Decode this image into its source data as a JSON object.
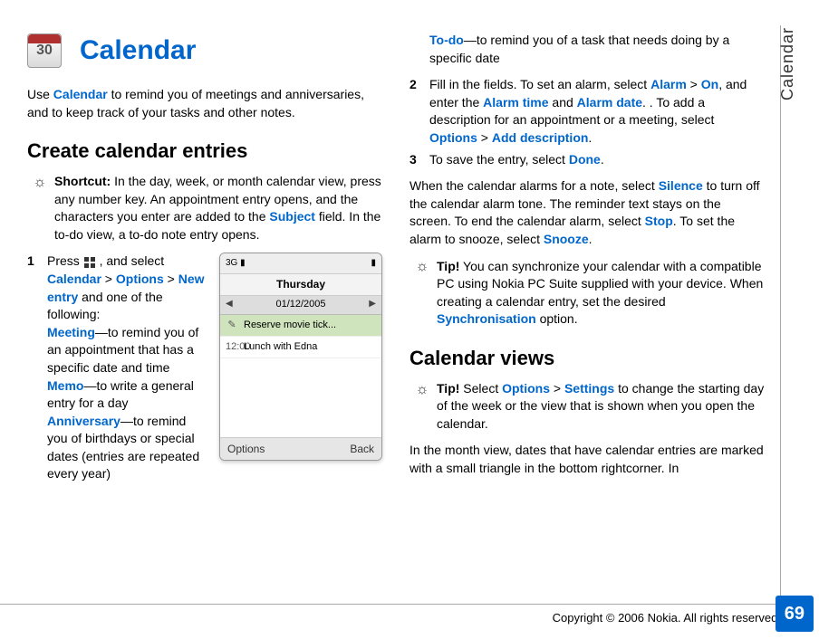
{
  "sideTab": "Calendar",
  "pageNumber": "69",
  "copyright": "Copyright © 2006 Nokia. All rights reserved.",
  "header": {
    "title": "Calendar",
    "iconDay": "30"
  },
  "left": {
    "intro_prefix": "Use ",
    "intro_app": "Calendar",
    "intro_suffix": " to remind you of meetings and anniversaries, and to keep track of your tasks and other notes.",
    "h2_create": "Create calendar entries",
    "shortcut_label": "Shortcut:",
    "shortcut_prefix": " In the day, week, or month calendar view, press any number key. An appointment entry opens, and the characters you enter are added to the ",
    "shortcut_field": "Subject",
    "shortcut_suffix": " field. In the to-do view, a to-do note entry opens.",
    "step1": {
      "num": "1",
      "t0": "Press ",
      "t1": " , and select ",
      "calendar": "Calendar",
      "gt1": " > ",
      "options": "Options",
      "gt2": " > ",
      "newentry": "New entry",
      "t2": " and one of the following:",
      "meeting": "Meeting",
      "meeting_t": "—to remind you of an appointment that has a specific date and time",
      "memo": "Memo",
      "memo_t": "—to write a general entry for a day",
      "anniversary": "Anniversary",
      "anniversary_t": "—to remind you of birthdays or special dates (entries are repeated every year)"
    }
  },
  "right": {
    "todo": "To-do",
    "todo_t": "—to remind you of a task that needs doing by a specific date",
    "step2": {
      "num": "2",
      "t0": "Fill in the fields. To set an alarm, select ",
      "alarm": "Alarm",
      "gt1": " > ",
      "on": "On",
      "t1": ", and enter the ",
      "alarmtime": "Alarm time",
      "and": " and ",
      "alarmdate": "Alarm date",
      "t2": ". To add a description for an appointment or a meeting, select ",
      "options": "Options",
      "gt2": " > ",
      "adddesc": "Add description",
      "dot": "."
    },
    "step3": {
      "num": "3",
      "t0": "To save the entry, select ",
      "done": "Done",
      "dot": "."
    },
    "alarmPara": {
      "t0": "When the calendar alarms for a note, select ",
      "silence": "Silence",
      "t1": " to turn off the calendar alarm tone. The reminder text stays on the screen. To end the calendar alarm, select ",
      "stop": "Stop",
      "t2": ". To set the alarm to snooze, select ",
      "snooze": "Snooze",
      "dot": "."
    },
    "tip1": {
      "label": "Tip!",
      "t0": " You can synchronize your calendar with a compatible PC using Nokia PC Suite supplied with your device. When creating a calendar entry, set the desired ",
      "sync": "Synchronisation",
      "t1": " option."
    },
    "h2_views": "Calendar views",
    "tip2": {
      "label": "Tip!",
      "t0": " Select ",
      "options": "Options",
      "gt": " > ",
      "settings": "Settings",
      "t1": " to change the starting day of the week or the view that is shown when you open the calendar."
    },
    "monthPara": "In the month view, dates that have calendar entries are marked with a small triangle in the bottom rightcorner. In"
  },
  "phone": {
    "net": "3G",
    "sigIcon": "▮",
    "batIcon": "▮",
    "day": "Thursday",
    "date": "01/12/2005",
    "entry1": "Reserve movie tick...",
    "entry2_time": "12:00",
    "entry2": "Lunch with Edna",
    "left": "Options",
    "right": "Back"
  }
}
